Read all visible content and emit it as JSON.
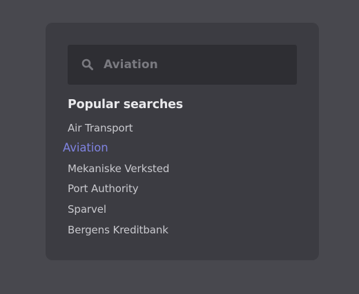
{
  "search": {
    "value": "Aviation",
    "icon": "search-icon"
  },
  "popular": {
    "title": "Popular searches",
    "items": [
      {
        "label": "Air Transport",
        "active": false
      },
      {
        "label": "Aviation",
        "active": true
      },
      {
        "label": "Mekaniske Verksted",
        "active": false
      },
      {
        "label": "Port Authority",
        "active": false
      },
      {
        "label": "Sparvel",
        "active": false
      },
      {
        "label": "Bergens Kreditbank",
        "active": false
      }
    ]
  },
  "colors": {
    "background": "#48484e",
    "panel": "#3c3c42",
    "search_box": "#2e2e33",
    "accent": "#7f83e0",
    "title_text": "#e9e9ec",
    "item_text": "#c9c9ce",
    "muted_text": "#7a7a80"
  }
}
